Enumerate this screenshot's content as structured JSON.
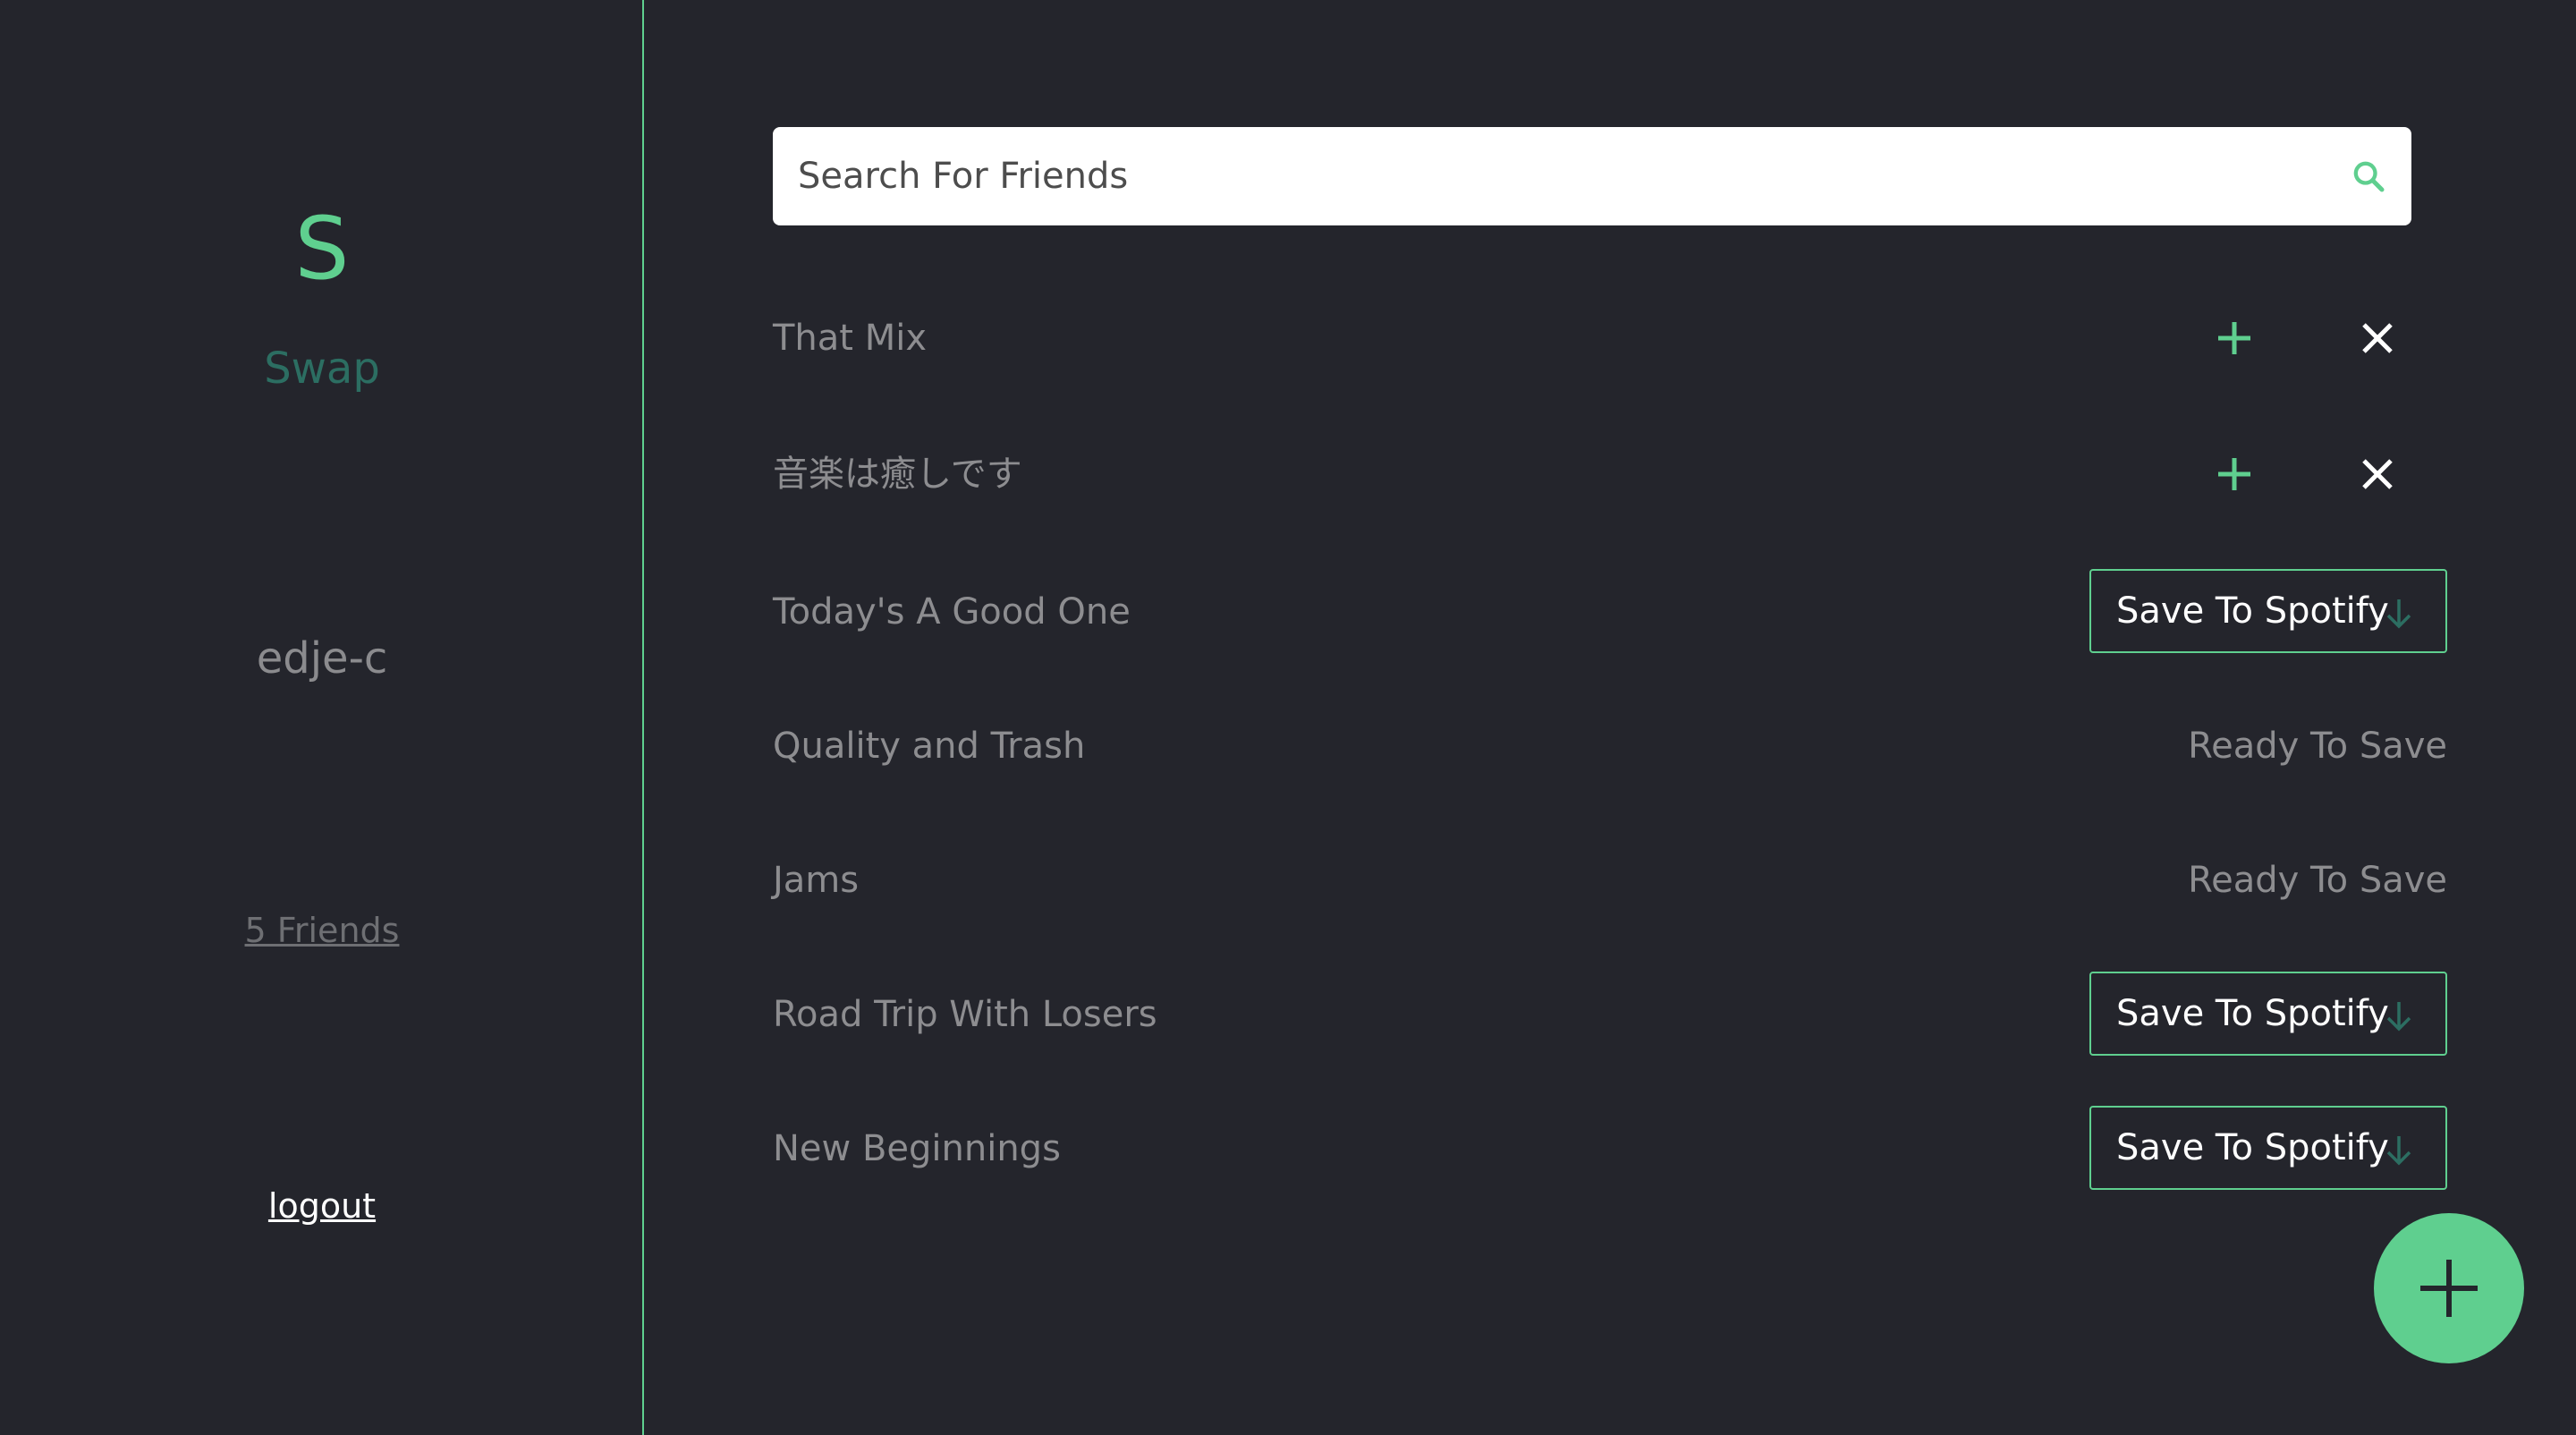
{
  "sidebar": {
    "logo_letter": "S",
    "app_name": "Swap",
    "username": "edje-c",
    "friends_link": "5 Friends",
    "logout_link": "logout"
  },
  "search": {
    "placeholder": "Search For Friends",
    "value": ""
  },
  "playlists": [
    {
      "title": "That Mix",
      "action": "accept-or-decline"
    },
    {
      "title": "音楽は癒しです",
      "action": "accept-or-decline"
    },
    {
      "title": "Today's A Good One",
      "action": "save",
      "button_label": "Save To Spotify"
    },
    {
      "title": "Quality and Trash",
      "action": "status",
      "status": "Ready To Save"
    },
    {
      "title": "Jams",
      "action": "status",
      "status": "Ready To Save"
    },
    {
      "title": "Road Trip With Losers",
      "action": "save",
      "button_label": "Save To Spotify"
    },
    {
      "title": "New Beginnings",
      "action": "save",
      "button_label": "Save To Spotify"
    }
  ],
  "icons": {
    "search": "search-icon",
    "add": "plus-icon",
    "decline": "close-icon",
    "download": "arrow-down-icon",
    "fab": "plus-icon"
  },
  "colors": {
    "background": "#24252c",
    "accent": "#5fcf8f",
    "app_name": "#2c6e62",
    "muted_text": "#8d8d90",
    "arrow": "#2c6e62"
  }
}
